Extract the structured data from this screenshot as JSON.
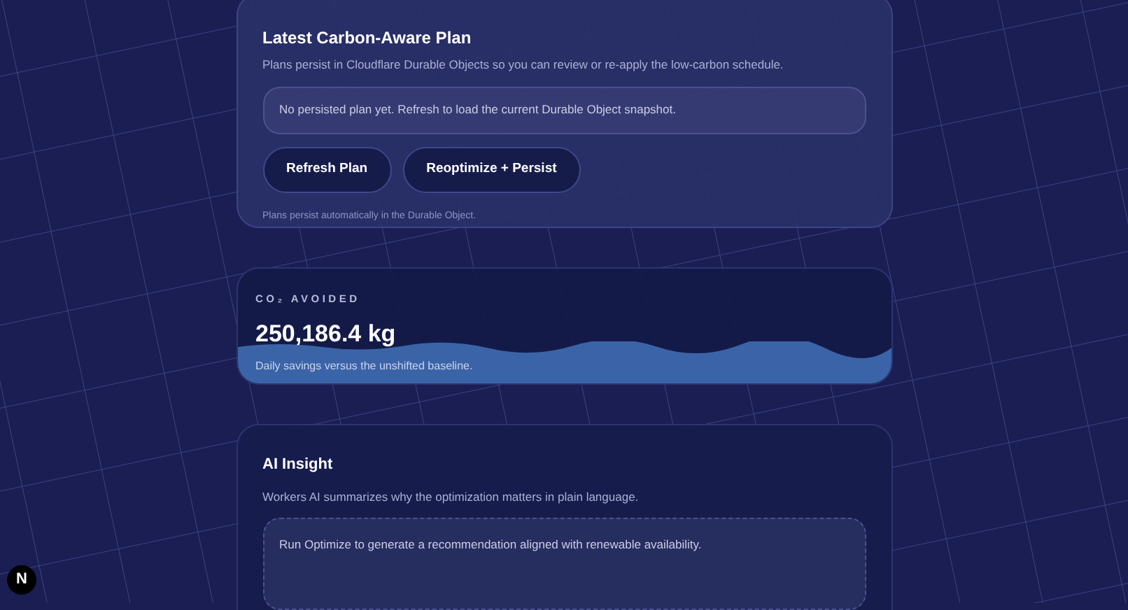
{
  "plan_card": {
    "title": "Latest Carbon-Aware Plan",
    "description": "Plans persist in Cloudflare Durable Objects so you can review or re-apply the low-carbon schedule.",
    "notice": "No persisted plan yet. Refresh to load the current Durable Object snapshot.",
    "buttons": [
      "Refresh Plan",
      "Reoptimize + Persist"
    ],
    "footnote": "Plans persist automatically in the Durable Object."
  },
  "metric_card": {
    "label": "CO₂ AVOIDED",
    "value": "250,186.4 kg",
    "caption": "Daily savings versus the unshifted baseline."
  },
  "insight_card": {
    "title": "AI Insight",
    "description": "Workers AI summarizes why the optimization matters in plain language.",
    "message": "Run Optimize to generate a recommendation aligned with renewable availability."
  },
  "dev_badge": "N"
}
